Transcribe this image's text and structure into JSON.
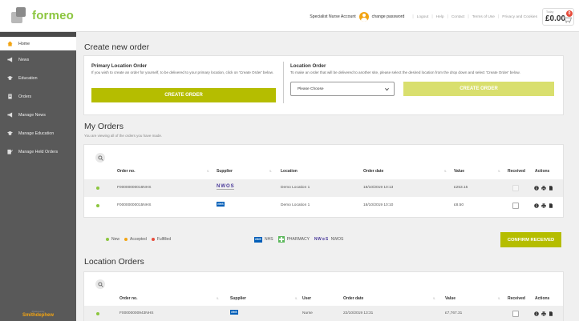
{
  "header": {
    "logo_text": "formeo",
    "account_label": "Specialist Nurse Account",
    "change_password": "change password",
    "links": [
      "Logout",
      "Help",
      "Contact",
      "Terms of Use",
      "Privacy and Cookies"
    ],
    "cart_label": "Today",
    "cart_value": "£0.00",
    "cart_badge": "0"
  },
  "sidebar": {
    "items": [
      {
        "label": "Home",
        "icon": "home-icon"
      },
      {
        "label": "News",
        "icon": "megaphone-icon"
      },
      {
        "label": "Education",
        "icon": "graduation-cap-icon"
      },
      {
        "label": "Orders",
        "icon": "document-icon"
      },
      {
        "label": "Manage News",
        "icon": "megaphone-icon"
      },
      {
        "label": "Manage Education",
        "icon": "graduation-cap-icon"
      },
      {
        "label": "Manage Held Orders",
        "icon": "edit-icon"
      }
    ],
    "powered_by": "Powered by",
    "brand": "Smithdephew"
  },
  "create_order": {
    "title": "Create new order",
    "primary": {
      "title": "Primary Location Order",
      "text": "If you wish to create an order for yourself, to be delivered to your primary location, click on 'Create Order' below.",
      "button": "CREATE ORDER"
    },
    "location": {
      "title": "Location Order",
      "text": "To make an order that will be delivered to another site, please select the desired location from the drop down and select 'Create Order' below.",
      "select_value": "Please Choose",
      "button": "CREATE ORDER"
    }
  },
  "my_orders": {
    "title": "My Orders",
    "subtitle": "You are viewing all of the orders you have made.",
    "headers": [
      "Order no.",
      "Supplier",
      "Location",
      "Order date",
      "Value",
      "Received",
      "Actions"
    ],
    "rows": [
      {
        "order_no": "F00000000016NHS",
        "supplier": "NWOS",
        "location": "Demo Location 1",
        "date": "18/10/2019 10:13",
        "value": "£253.15",
        "status_color": "#8cc63f"
      },
      {
        "order_no": "F00000000015NHS",
        "supplier": "NHS",
        "location": "Demo Location 1",
        "date": "18/10/2019 10:10",
        "value": "£8.50",
        "status_color": "#8cc63f"
      }
    ],
    "legend": {
      "new": "New",
      "accepted": "Accepted",
      "fulfilled": "Fulfilled",
      "nhs": "NHS",
      "pharmacy": "PHARMACY",
      "nwos": "NWOS"
    },
    "confirm_button": "CONFIRM RECEIVED"
  },
  "location_orders": {
    "title": "Location Orders",
    "headers": [
      "Order no.",
      "Supplier",
      "User",
      "Order date",
      "Value",
      "Received",
      "Actions"
    ],
    "rows": [
      {
        "order_no": "F00000000943NHS",
        "supplier": "NHS",
        "user": "Nurse",
        "date": "22/10/2019 13:31",
        "value": "£7,767.31",
        "status_color": "#8cc63f"
      }
    ]
  },
  "colors": {
    "accent": "#b5bd00",
    "brand_green": "#8cc63f",
    "new": "#8cc63f",
    "accepted": "#f2a413",
    "fulfilled": "#e74c3c",
    "sidebar": "#595959"
  }
}
